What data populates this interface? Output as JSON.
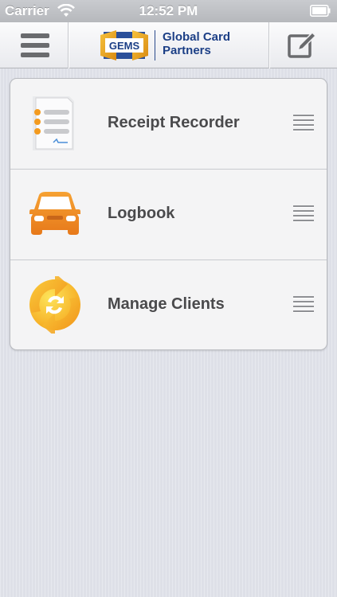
{
  "status_bar": {
    "carrier": "Carrier",
    "time": "12:52 PM",
    "wifi_icon": "wifi-icon",
    "battery_icon": "battery-icon"
  },
  "nav_bar": {
    "menu_icon": "hamburger-menu-icon",
    "compose_icon": "compose-edit-icon",
    "logo": {
      "badge_text": "GEMS",
      "line1": "Global Card",
      "line2": "Partners"
    },
    "brand_color": "#1c3f86"
  },
  "menu": {
    "items": [
      {
        "label": "Receipt Recorder",
        "icon": "receipt-document-icon",
        "accent": "#f39a1e"
      },
      {
        "label": "Logbook",
        "icon": "car-icon",
        "accent": "#f08a1c"
      },
      {
        "label": "Manage Clients",
        "icon": "sync-arrows-icon",
        "accent": "#f5b81a"
      }
    ],
    "drag_handle_icon": "drag-handle-icon"
  }
}
